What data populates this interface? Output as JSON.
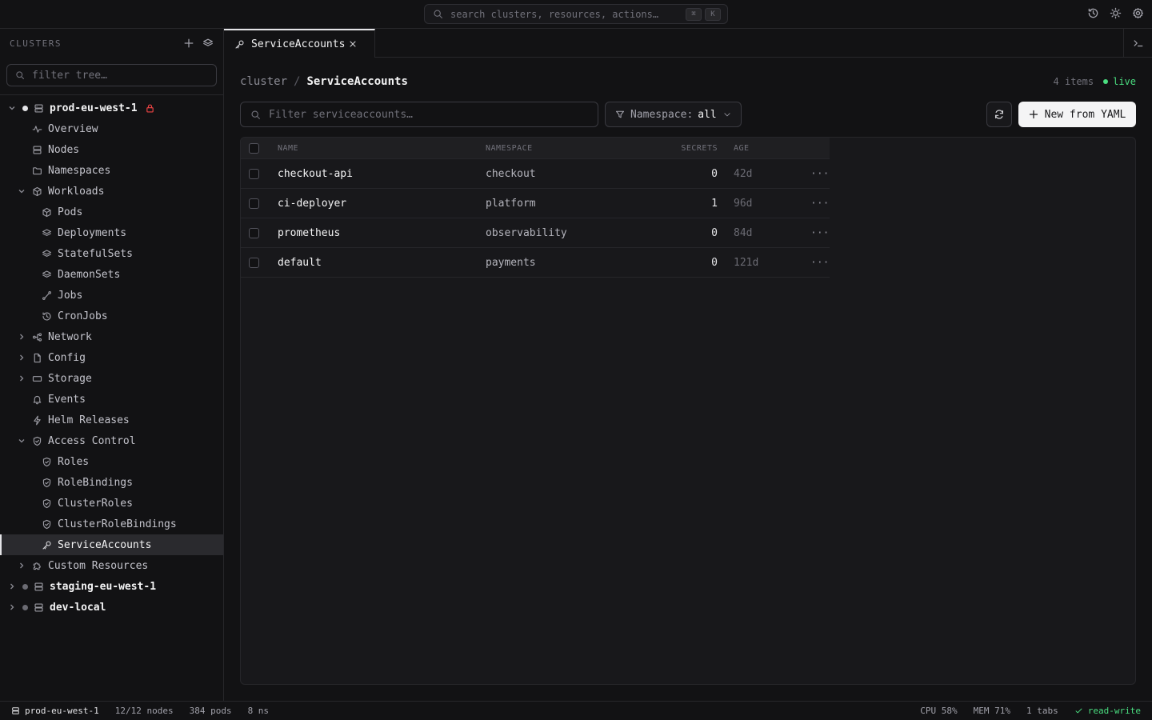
{
  "topbar": {
    "search_placeholder": "search clusters, resources, actions…",
    "kbd_mod": "⌘",
    "kbd_key": "K",
    "icons": [
      "history-icon",
      "sun-icon",
      "gear-icon"
    ]
  },
  "sidebar": {
    "title": "CLUSTERS",
    "filter_placeholder": "filter tree…",
    "clusters": [
      {
        "name": "prod-eu-west-1",
        "status_color": "#e4e4e7",
        "expanded": true,
        "locked": true,
        "items": [
          {
            "label": "Overview",
            "icon": "pulse-icon"
          },
          {
            "label": "Nodes",
            "icon": "server-icon"
          },
          {
            "label": "Namespaces",
            "icon": "folder-icon"
          },
          {
            "label": "Workloads",
            "icon": "cube-icon",
            "expanded": true,
            "children": [
              {
                "label": "Pods",
                "icon": "cube-icon"
              },
              {
                "label": "Deployments",
                "icon": "layers-icon"
              },
              {
                "label": "StatefulSets",
                "icon": "layers-icon"
              },
              {
                "label": "DaemonSets",
                "icon": "layers-icon"
              },
              {
                "label": "Jobs",
                "icon": "route-icon"
              },
              {
                "label": "CronJobs",
                "icon": "history-icon"
              }
            ]
          },
          {
            "label": "Network",
            "icon": "network-icon",
            "expanded": false
          },
          {
            "label": "Config",
            "icon": "file-icon",
            "expanded": false
          },
          {
            "label": "Storage",
            "icon": "disk-icon",
            "expanded": false
          },
          {
            "label": "Events",
            "icon": "bell-icon"
          },
          {
            "label": "Helm Releases",
            "icon": "bolt-icon"
          },
          {
            "label": "Access Control",
            "icon": "shield-icon",
            "expanded": true,
            "children": [
              {
                "label": "Roles",
                "icon": "shield-icon"
              },
              {
                "label": "RoleBindings",
                "icon": "shield-icon"
              },
              {
                "label": "ClusterRoles",
                "icon": "shield-icon"
              },
              {
                "label": "ClusterRoleBindings",
                "icon": "shield-icon"
              },
              {
                "label": "ServiceAccounts",
                "icon": "key-icon",
                "active": true
              }
            ]
          },
          {
            "label": "Custom Resources",
            "icon": "puzzle-icon",
            "expanded": false
          }
        ]
      },
      {
        "name": "staging-eu-west-1",
        "status_color": "#6b6b73",
        "expanded": false
      },
      {
        "name": "dev-local",
        "status_color": "#6b6b73",
        "expanded": false
      }
    ]
  },
  "tabs": [
    {
      "label": "ServiceAccounts",
      "icon": "key-icon",
      "active": true
    }
  ],
  "main": {
    "breadcrumb_root": "cluster",
    "breadcrumb_sep": "/",
    "breadcrumb_current": "ServiceAccounts",
    "item_count": "4 items",
    "live_label": "live",
    "filter_placeholder": "Filter serviceaccounts…",
    "namespace_label": "Namespace:",
    "namespace_value": "all",
    "new_button": "New from YAML",
    "columns": [
      "NAME",
      "NAMESPACE",
      "SECRETS",
      "AGE"
    ],
    "rows": [
      {
        "name": "checkout-api",
        "namespace": "checkout",
        "secrets": "0",
        "age": "42d"
      },
      {
        "name": "ci-deployer",
        "namespace": "platform",
        "secrets": "1",
        "age": "96d"
      },
      {
        "name": "prometheus",
        "namespace": "observability",
        "secrets": "0",
        "age": "84d"
      },
      {
        "name": "default",
        "namespace": "payments",
        "secrets": "0",
        "age": "121d"
      }
    ],
    "row_menu": "···"
  },
  "statusbar": {
    "cluster": "prod-eu-west-1",
    "nodes": "12/12 nodes",
    "pods": "384 pods",
    "namespaces": "8 ns",
    "cpu": "CPU 58%",
    "mem": "MEM 71%",
    "tabs": "1 tabs",
    "mode": "read-write"
  },
  "colors": {
    "accent_green": "#4ade80",
    "danger": "#ef4444",
    "background": "#121214"
  }
}
